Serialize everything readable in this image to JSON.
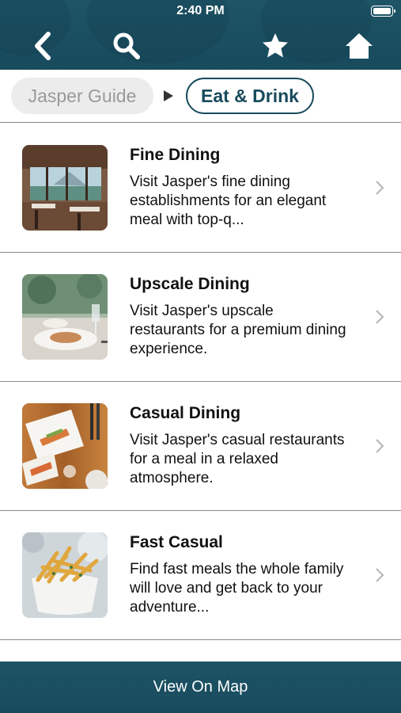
{
  "status_bar": {
    "time": "2:40 PM"
  },
  "breadcrumb": {
    "parent": "Jasper Guide",
    "current": "Eat & Drink"
  },
  "items": [
    {
      "title": "Fine Dining",
      "description": "Visit Jasper's fine dining establishments for an elegant meal with top-q...",
      "image": "restaurant-interior-lake-view"
    },
    {
      "title": "Upscale Dining",
      "description": "Visit Jasper's upscale restaurants for a premium dining experience.",
      "image": "plated-dish-wine-glass"
    },
    {
      "title": "Casual Dining",
      "description": "Visit Jasper's casual restaurants for a meal in a relaxed atmosphere.",
      "image": "skewers-on-wooden-table"
    },
    {
      "title": "Fast Casual",
      "description": "Find fast meals the whole family will love and get back to your adventure...",
      "image": "bowl-of-fries"
    }
  ],
  "footer": {
    "map_label": "View On Map"
  },
  "colors": {
    "brand": "#184a5c",
    "divider": "#8a8a8a",
    "pill_bg": "#ececec"
  },
  "icons": {
    "back": "chevron-left-icon",
    "search": "search-icon",
    "favorite": "star-icon",
    "home": "home-icon",
    "row_chevron": "chevron-right-icon"
  }
}
